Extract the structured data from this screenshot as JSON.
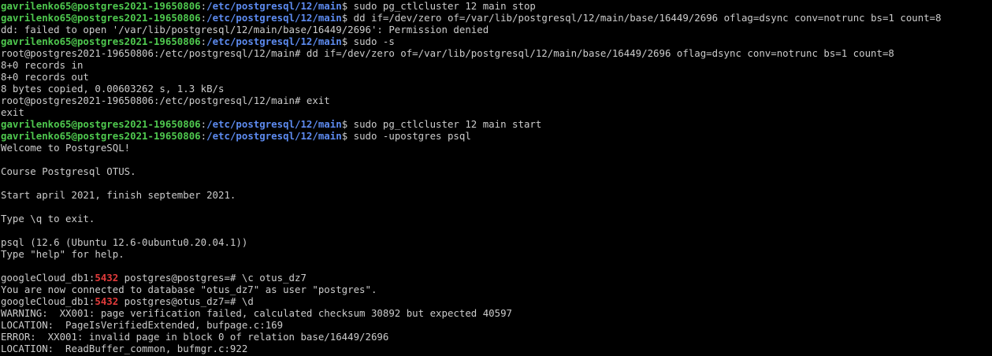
{
  "colors": {
    "background": "#000000",
    "text": "#cccccc",
    "prompt_user": "#4fc94f",
    "prompt_path": "#5d8bf0",
    "psql_port": "#e23b3b"
  },
  "lines": [
    [
      [
        "g",
        "gavrilenko65@postgres2021-19650806"
      ],
      [
        "p",
        ":"
      ],
      [
        "b",
        "/etc/postgresql/12/main"
      ],
      [
        "p",
        "$ sudo pg_ctlcluster 12 main stop"
      ]
    ],
    [
      [
        "g",
        "gavrilenko65@postgres2021-19650806"
      ],
      [
        "p",
        ":"
      ],
      [
        "b",
        "/etc/postgresql/12/main"
      ],
      [
        "p",
        "$ dd if=/dev/zero of=/var/lib/postgresql/12/main/base/16449/2696 oflag=dsync conv=notrunc bs=1 count=8"
      ]
    ],
    [
      [
        "p",
        "dd: failed to open '/var/lib/postgresql/12/main/base/16449/2696': Permission denied"
      ]
    ],
    [
      [
        "g",
        "gavrilenko65@postgres2021-19650806"
      ],
      [
        "p",
        ":"
      ],
      [
        "b",
        "/etc/postgresql/12/main"
      ],
      [
        "p",
        "$ sudo -s"
      ]
    ],
    [
      [
        "p",
        "root@postgres2021-19650806:/etc/postgresql/12/main# dd if=/dev/zero of=/var/lib/postgresql/12/main/base/16449/2696 oflag=dsync conv=notrunc bs=1 count=8"
      ]
    ],
    [
      [
        "p",
        "8+0 records in"
      ]
    ],
    [
      [
        "p",
        "8+0 records out"
      ]
    ],
    [
      [
        "p",
        "8 bytes copied, 0.00603262 s, 1.3 kB/s"
      ]
    ],
    [
      [
        "p",
        "root@postgres2021-19650806:/etc/postgresql/12/main# exit"
      ]
    ],
    [
      [
        "p",
        "exit"
      ]
    ],
    [
      [
        "g",
        "gavrilenko65@postgres2021-19650806"
      ],
      [
        "p",
        ":"
      ],
      [
        "b",
        "/etc/postgresql/12/main"
      ],
      [
        "p",
        "$ sudo pg_ctlcluster 12 main start"
      ]
    ],
    [
      [
        "g",
        "gavrilenko65@postgres2021-19650806"
      ],
      [
        "p",
        ":"
      ],
      [
        "b",
        "/etc/postgresql/12/main"
      ],
      [
        "p",
        "$ sudo -upostgres psql"
      ]
    ],
    [
      [
        "p",
        "Welcome to PostgreSQL!"
      ]
    ],
    [
      [
        "p",
        ""
      ]
    ],
    [
      [
        "p",
        "Course Postgresql OTUS."
      ]
    ],
    [
      [
        "p",
        ""
      ]
    ],
    [
      [
        "p",
        "Start april 2021, finish september 2021."
      ]
    ],
    [
      [
        "p",
        ""
      ]
    ],
    [
      [
        "p",
        "Type \\q to exit."
      ]
    ],
    [
      [
        "p",
        ""
      ]
    ],
    [
      [
        "p",
        "psql (12.6 (Ubuntu 12.6-0ubuntu0.20.04.1))"
      ]
    ],
    [
      [
        "p",
        "Type \"help\" for help."
      ]
    ],
    [
      [
        "p",
        ""
      ]
    ],
    [
      [
        "p",
        "googleCloud_db1:"
      ],
      [
        "r",
        "5432"
      ],
      [
        "p",
        " postgres@postgres=# \\c otus_dz7"
      ]
    ],
    [
      [
        "p",
        "You are now connected to database \"otus_dz7\" as user \"postgres\"."
      ]
    ],
    [
      [
        "p",
        "googleCloud_db1:"
      ],
      [
        "r",
        "5432"
      ],
      [
        "p",
        " postgres@otus_dz7=# \\d"
      ]
    ],
    [
      [
        "p",
        "WARNING:  XX001: page verification failed, calculated checksum 30892 but expected 40597"
      ]
    ],
    [
      [
        "p",
        "LOCATION:  PageIsVerifiedExtended, bufpage.c:169"
      ]
    ],
    [
      [
        "p",
        "ERROR:  XX001: invalid page in block 0 of relation base/16449/2696"
      ]
    ],
    [
      [
        "p",
        "LOCATION:  ReadBuffer_common, bufmgr.c:922"
      ]
    ]
  ]
}
